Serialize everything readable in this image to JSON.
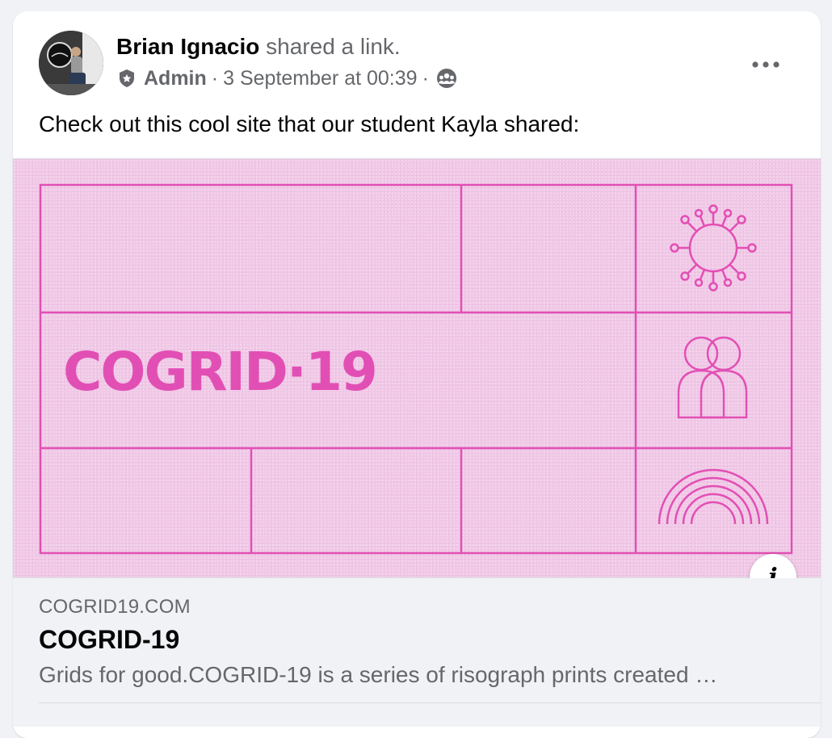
{
  "post": {
    "author_name": "Brian Ignacio",
    "action_text": "shared a link.",
    "role": "Admin",
    "separator": "·",
    "timestamp": "3 September at 00:39",
    "audience_icon": "group-icon",
    "badge_icon": "admin-badge-icon",
    "more_icon": "more-options-icon",
    "body_text": "Check out this cool site that our student Kayla shared:"
  },
  "link_preview": {
    "image_title": "COGRID·19",
    "domain": "COGRID19.COM",
    "title": "COGRID-19",
    "description": "Grids for good.COGRID-19 is a series of risograph prints created …",
    "info_icon": "info-icon",
    "info_glyph": "i"
  },
  "colors": {
    "preview_background": "#f0c8e6",
    "preview_accent": "#e24fb4",
    "text_primary": "#050505",
    "text_secondary": "#65676b"
  }
}
